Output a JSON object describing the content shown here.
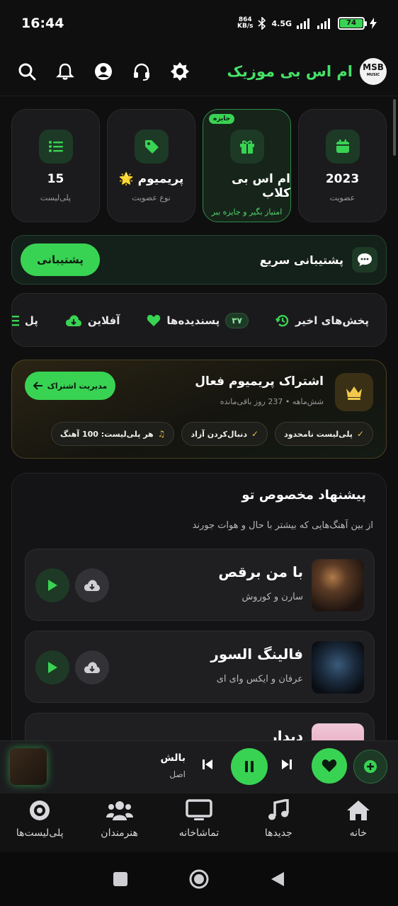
{
  "status_bar": {
    "time": "16:44",
    "net_speed_value": "864",
    "net_speed_unit": "KB/s",
    "network": "4.5G",
    "battery": "74"
  },
  "header": {
    "title": "ام اس بی موزیک",
    "logo_text": "MSB",
    "logo_sub": "MUSIC"
  },
  "stats": [
    {
      "value": "15",
      "label": "پلی‌لیست",
      "icon": "list-icon"
    },
    {
      "value": "پریمیوم 🌟",
      "label": "نوع عضویت",
      "icon": "tag-icon"
    },
    {
      "value": "ام اس بی کلاب",
      "label": "امتیاز بگیر و جایزه ببر",
      "icon": "gift-icon",
      "badge": "جایزه"
    },
    {
      "value": "2023",
      "label": "عضویت",
      "icon": "calendar-icon"
    }
  ],
  "support": {
    "label": "پشتیبانی سریع",
    "button": "پشتیبانی"
  },
  "quick_tabs": [
    {
      "label": "پخش‌های اخیر",
      "icon": "history-icon"
    },
    {
      "label": "پسندیده‌ها",
      "count": "۳۷",
      "icon": "heart-icon"
    },
    {
      "label": "آفلاین",
      "icon": "cloud-download-icon"
    },
    {
      "label": "پل",
      "icon": "list-icon"
    }
  ],
  "subscription": {
    "title": "اشتراک پریمیوم فعال",
    "desc": "شش‌ماهه • 237 روز باقی‌مانده",
    "manage": "مدیریت اشتراک",
    "chips": [
      "پلی‌لیست نامحدود",
      "دنبال‌کردن آزاد",
      "هر پلی‌لیست: 100 آهنگ"
    ]
  },
  "recommendations": {
    "title": "پیشنهاد مخصوص تو",
    "desc": "از بین آهنگ‌هایی که بیشتر با حال و هوات جورند",
    "songs": [
      {
        "title": "با من برقص",
        "artist": "سارن و کوروش"
      },
      {
        "title": "فالینگ السور",
        "artist": "عرفان و ایکس وای ای"
      },
      {
        "title": "دیدار",
        "artist": ""
      }
    ]
  },
  "player": {
    "title": "بالش",
    "subtitle": "اصل"
  },
  "bottom_nav": [
    "خانه",
    "جدیدها",
    "تماشاخانه",
    "هنرمندان",
    "پلی‌لیست‌ها"
  ],
  "colors": {
    "accent": "#39d353",
    "background": "#0f0f10",
    "gold": "#e0c04a"
  }
}
